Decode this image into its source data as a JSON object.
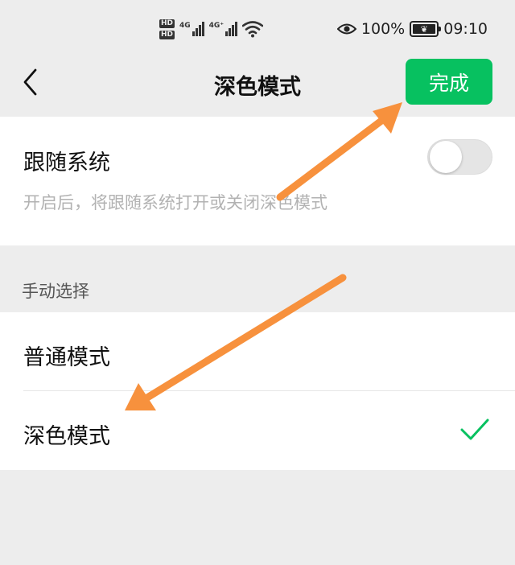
{
  "status_bar": {
    "hd_badge_1": "HD",
    "hd_badge_2": "HD",
    "net1": "4G",
    "net2": "4G⁺",
    "battery_percent": "100%",
    "time": "09:10",
    "icons": [
      "eye-icon",
      "wifi-icon",
      "battery-icon",
      "signal-icon"
    ]
  },
  "nav": {
    "title": "深色模式",
    "done_label": "完成",
    "back_icon": "chevron-left-icon"
  },
  "follow_system": {
    "title": "跟随系统",
    "description": "开启后，将跟随系统打开或关闭深色模式",
    "enabled": false
  },
  "manual": {
    "header": "手动选择",
    "options": [
      {
        "label": "普通模式",
        "selected": false
      },
      {
        "label": "深色模式",
        "selected": true
      }
    ]
  },
  "colors": {
    "accent": "#07c160",
    "background": "#ededed",
    "annotation_arrow": "#f7913d"
  }
}
